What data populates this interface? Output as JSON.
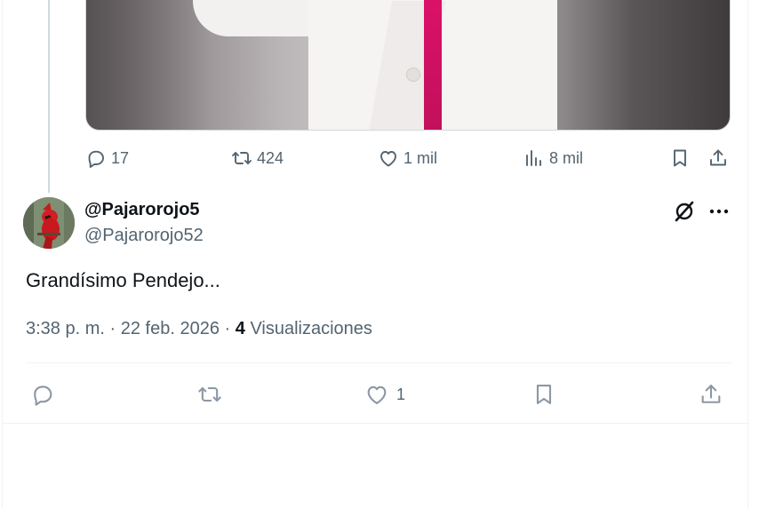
{
  "parent_tweet": {
    "actions": {
      "replies": "17",
      "reposts": "424",
      "likes": "1 mil",
      "views": "8 mil"
    }
  },
  "tweet": {
    "display_name": "@Pajarorojo5",
    "handle": "@Pajarorojo52",
    "text": "Grandísimo Pendejo...",
    "time": "3:38 p. m.",
    "separator": "·",
    "date": "22 feb. 2026",
    "views_count": "4",
    "views_label": "Visualizaciones",
    "actions": {
      "likes": "1"
    }
  },
  "colors": {
    "text_primary": "#0f1419",
    "text_secondary": "#536471",
    "divider": "#eff3f4",
    "accent_tie": "#e0116b"
  },
  "icons": [
    "reply-icon",
    "repost-icon",
    "like-icon",
    "views-icon",
    "bookmark-icon",
    "share-icon",
    "grok-icon",
    "more-icon"
  ]
}
